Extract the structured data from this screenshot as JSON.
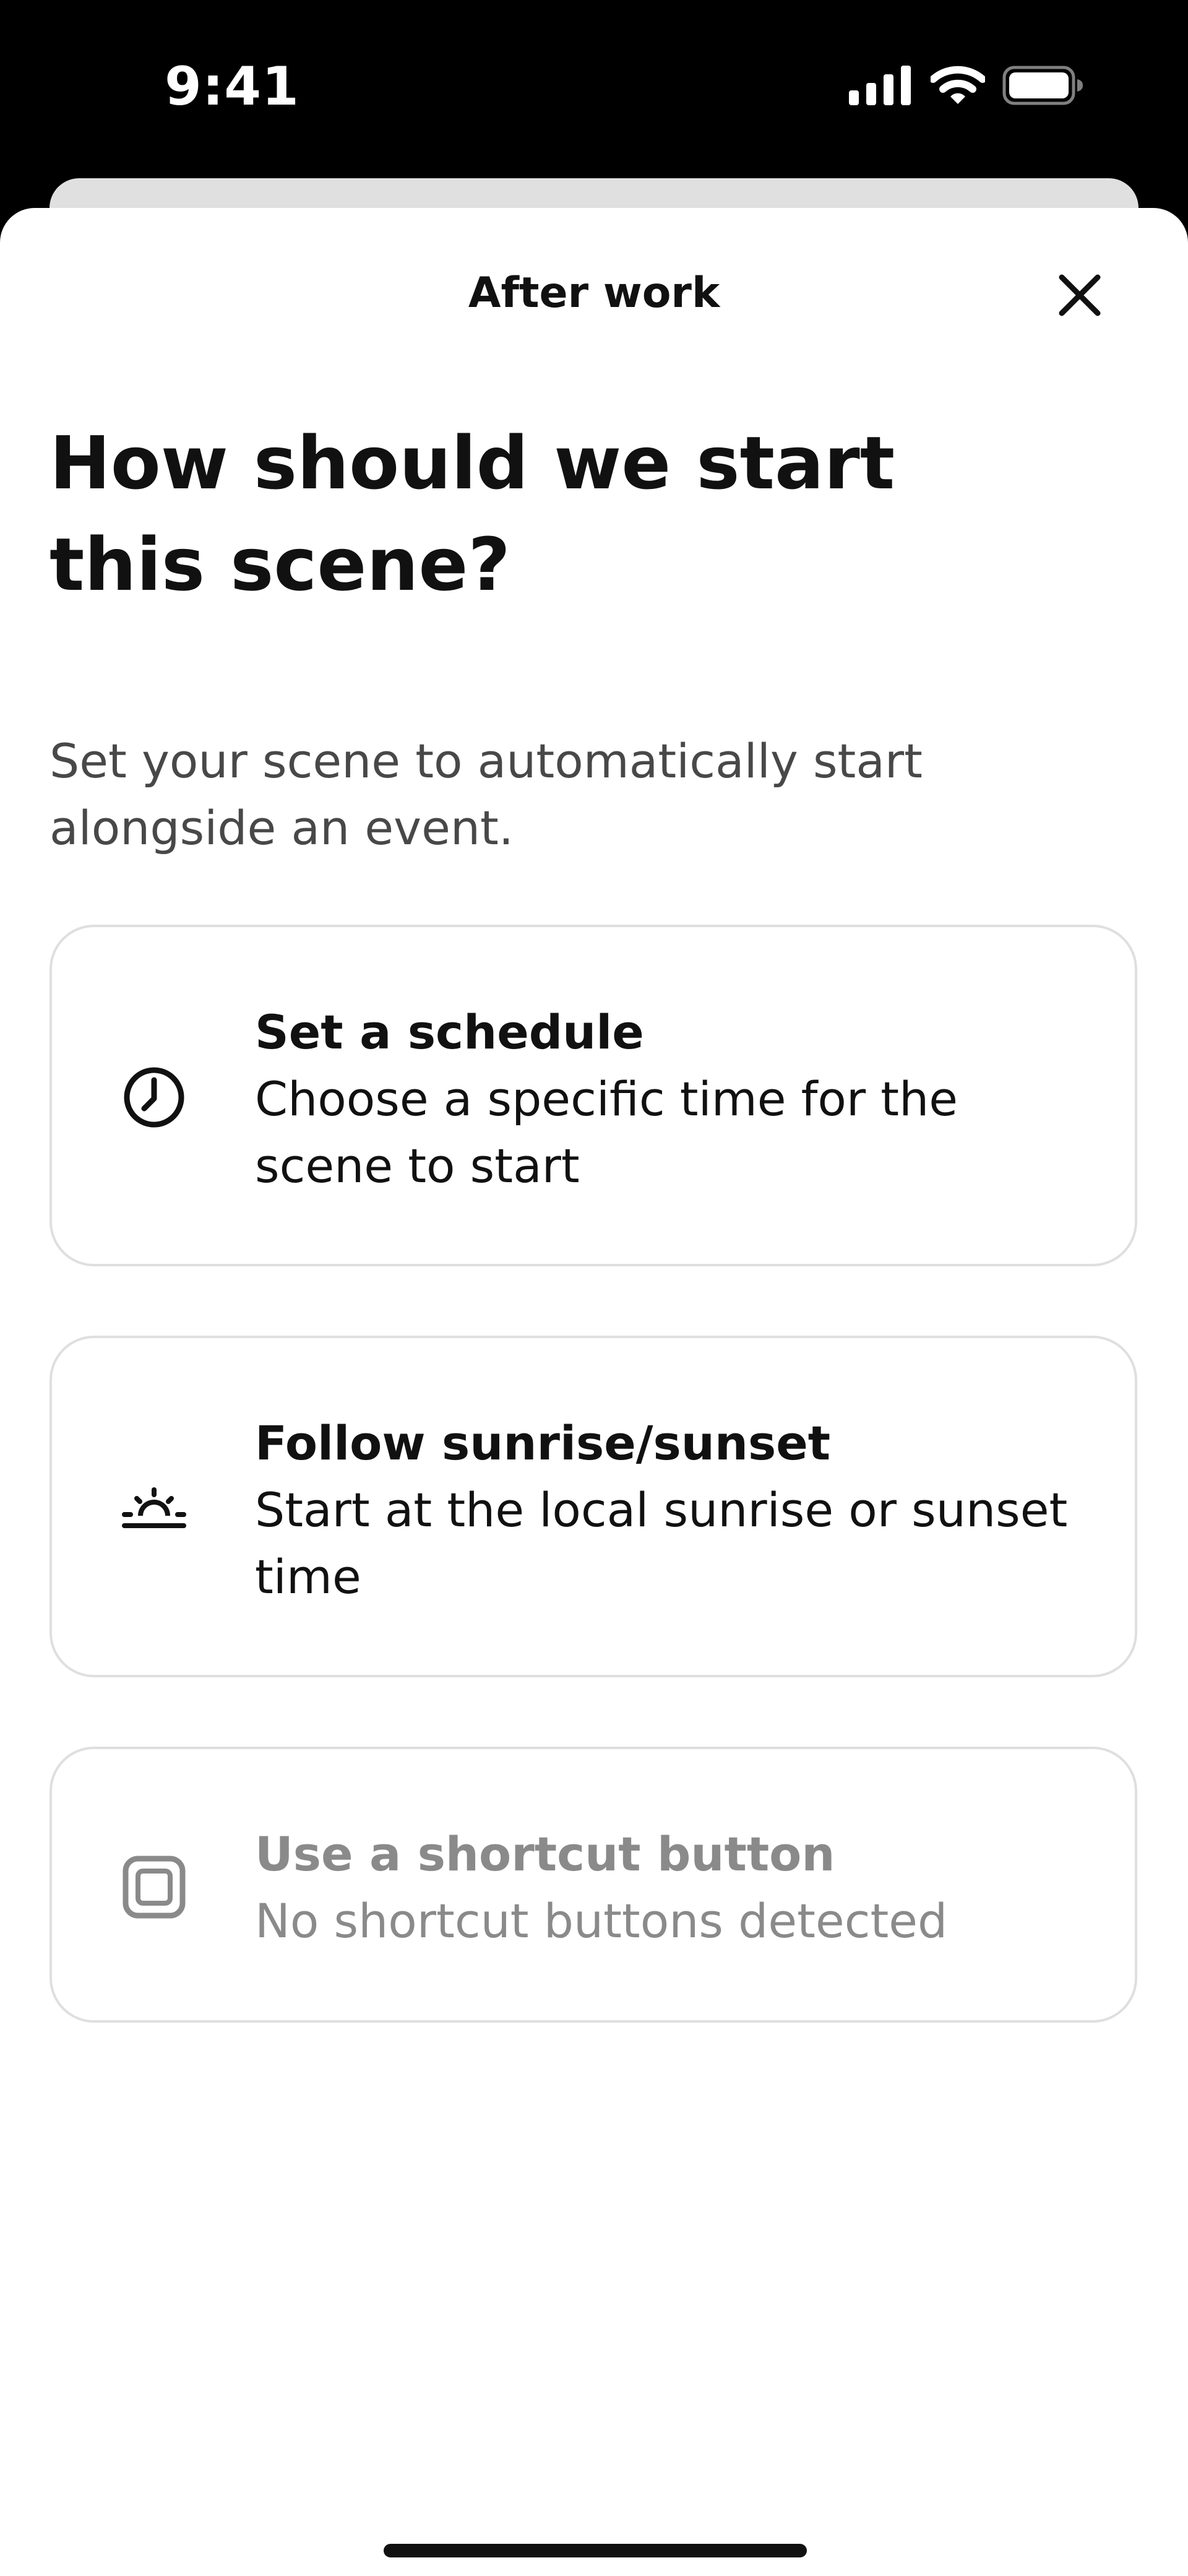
{
  "status_bar": {
    "time": "9:41"
  },
  "sheet": {
    "title": "After work"
  },
  "heading": "How should we start this scene?",
  "description": "Set your scene to automatically start alongside an event.",
  "options": [
    {
      "title": "Set a schedule",
      "subtitle": "Choose a specific time for the scene to start",
      "icon": "clock-icon",
      "enabled": true
    },
    {
      "title": "Follow sunrise/sunset",
      "subtitle": "Start at the local sunrise or sunset time",
      "icon": "sunrise-icon",
      "enabled": true
    },
    {
      "title": "Use a shortcut button",
      "subtitle": "No shortcut buttons detected",
      "icon": "shortcut-button-icon",
      "enabled": false
    }
  ],
  "colors": {
    "text_primary": "#111111",
    "text_secondary": "#484848",
    "text_disabled": "#8a8a8a",
    "card_border": "#dfdfdf",
    "status_bar_background": "#000000"
  }
}
